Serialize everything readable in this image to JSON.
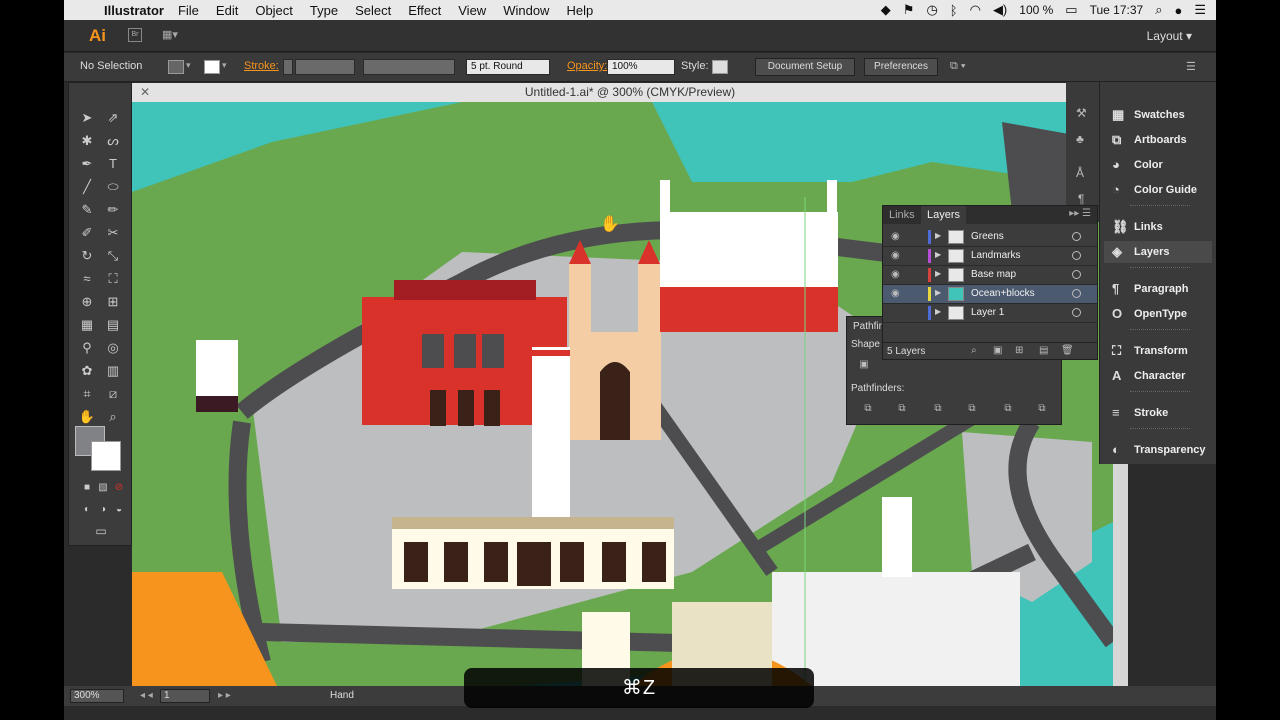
{
  "menubar": {
    "app_name": "Illustrator",
    "items": [
      "File",
      "Edit",
      "Object",
      "Type",
      "Select",
      "Effect",
      "View",
      "Window",
      "Help"
    ],
    "battery": "100 %",
    "clock": "Tue 17:37"
  },
  "appbar": {
    "logo": "Ai",
    "bridge": "Br",
    "workspace": "Layout"
  },
  "controlbar": {
    "selection": "No Selection",
    "stroke_label": "Stroke:",
    "brush": "5 pt. Round",
    "opacity_label": "Opacity:",
    "opacity_value": "100%",
    "style_label": "Style:",
    "document_setup": "Document Setup",
    "preferences": "Preferences"
  },
  "document": {
    "title": "Untitled-1.ai* @ 300% (CMYK/Preview)"
  },
  "statusbar": {
    "zoom": "300%",
    "artboard": "1",
    "tool": "Hand"
  },
  "overlay": {
    "shortcut": "⌘Z"
  },
  "layers_panel": {
    "tabs": [
      "Links",
      "Layers"
    ],
    "active_tab": "Layers",
    "layers": [
      {
        "name": "Greens",
        "color": "#4f6bd8"
      },
      {
        "name": "Landmarks",
        "color": "#b64ed6"
      },
      {
        "name": "Base map",
        "color": "#d94040"
      },
      {
        "name": "Ocean+blocks",
        "color": "#e8d840",
        "selected": true
      },
      {
        "name": "Layer 1",
        "color": "#4f6bd8"
      }
    ],
    "count": "5 Layers"
  },
  "pathfinder_panel": {
    "title": "Pathfin",
    "shape_label": "Shape M",
    "pathfinders_label": "Pathfinders:"
  },
  "dock": {
    "items": [
      {
        "label": "Swatches",
        "icon": "swatches-icon"
      },
      {
        "label": "Artboards",
        "icon": "artboards-icon"
      },
      {
        "label": "Color",
        "icon": "color-icon"
      },
      {
        "label": "Color Guide",
        "icon": "color-guide-icon"
      },
      {
        "label": "Links",
        "icon": "links-icon"
      },
      {
        "label": "Layers",
        "icon": "layers-icon",
        "active": true
      },
      {
        "label": "Paragraph",
        "icon": "paragraph-icon"
      },
      {
        "label": "OpenType",
        "icon": "opentype-icon"
      },
      {
        "label": "Transform",
        "icon": "transform-icon"
      },
      {
        "label": "Character",
        "icon": "character-icon"
      },
      {
        "label": "Stroke",
        "icon": "stroke-icon"
      },
      {
        "label": "Transparency",
        "icon": "transparency-icon"
      }
    ]
  },
  "colors": {
    "ocean": "#40c3b9",
    "green": "#6aa84f",
    "road": "#4d4d4f",
    "block": "#bcbec0",
    "red": "#d9322b",
    "accent": "#f7941d"
  }
}
